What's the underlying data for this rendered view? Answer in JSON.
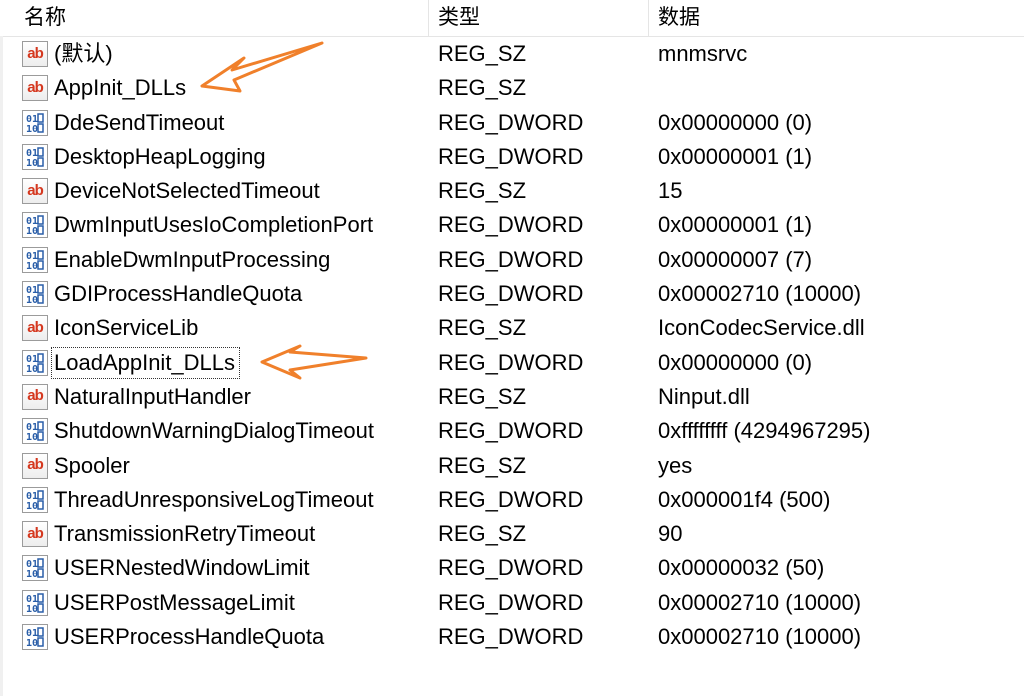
{
  "columns": {
    "name": "名称",
    "type": "类型",
    "data": "数据"
  },
  "rows": [
    {
      "icon": "string-value-icon",
      "name": "(默认)",
      "type": "REG_SZ",
      "data": "mnmsrvc"
    },
    {
      "icon": "string-value-icon",
      "name": "AppInit_DLLs",
      "type": "REG_SZ",
      "data": ""
    },
    {
      "icon": "binary-value-icon",
      "name": "DdeSendTimeout",
      "type": "REG_DWORD",
      "data": "0x00000000 (0)"
    },
    {
      "icon": "binary-value-icon",
      "name": "DesktopHeapLogging",
      "type": "REG_DWORD",
      "data": "0x00000001 (1)"
    },
    {
      "icon": "string-value-icon",
      "name": "DeviceNotSelectedTimeout",
      "type": "REG_SZ",
      "data": "15"
    },
    {
      "icon": "binary-value-icon",
      "name": "DwmInputUsesIoCompletionPort",
      "type": "REG_DWORD",
      "data": "0x00000001 (1)"
    },
    {
      "icon": "binary-value-icon",
      "name": "EnableDwmInputProcessing",
      "type": "REG_DWORD",
      "data": "0x00000007 (7)"
    },
    {
      "icon": "binary-value-icon",
      "name": "GDIProcessHandleQuota",
      "type": "REG_DWORD",
      "data": "0x00002710 (10000)"
    },
    {
      "icon": "string-value-icon",
      "name": "IconServiceLib",
      "type": "REG_SZ",
      "data": "IconCodecService.dll"
    },
    {
      "icon": "binary-value-icon",
      "name": "LoadAppInit_DLLs",
      "type": "REG_DWORD",
      "data": "0x00000000 (0)"
    },
    {
      "icon": "string-value-icon",
      "name": "NaturalInputHandler",
      "type": "REG_SZ",
      "data": "Ninput.dll"
    },
    {
      "icon": "binary-value-icon",
      "name": "ShutdownWarningDialogTimeout",
      "type": "REG_DWORD",
      "data": "0xffffffff (4294967295)"
    },
    {
      "icon": "string-value-icon",
      "name": "Spooler",
      "type": "REG_SZ",
      "data": "yes"
    },
    {
      "icon": "binary-value-icon",
      "name": "ThreadUnresponsiveLogTimeout",
      "type": "REG_DWORD",
      "data": "0x000001f4 (500)"
    },
    {
      "icon": "string-value-icon",
      "name": "TransmissionRetryTimeout",
      "type": "REG_SZ",
      "data": "90"
    },
    {
      "icon": "binary-value-icon",
      "name": "USERNestedWindowLimit",
      "type": "REG_DWORD",
      "data": "0x00000032 (50)"
    },
    {
      "icon": "binary-value-icon",
      "name": "USERPostMessageLimit",
      "type": "REG_DWORD",
      "data": "0x00002710 (10000)"
    },
    {
      "icon": "binary-value-icon",
      "name": "USERProcessHandleQuota",
      "type": "REG_DWORD",
      "data": "0x00002710 (10000)"
    }
  ],
  "colors": {
    "annotation_arrow": "#f0802b",
    "string_icon_text": "#d5381f",
    "binary_icon": "#2a5ea8"
  }
}
